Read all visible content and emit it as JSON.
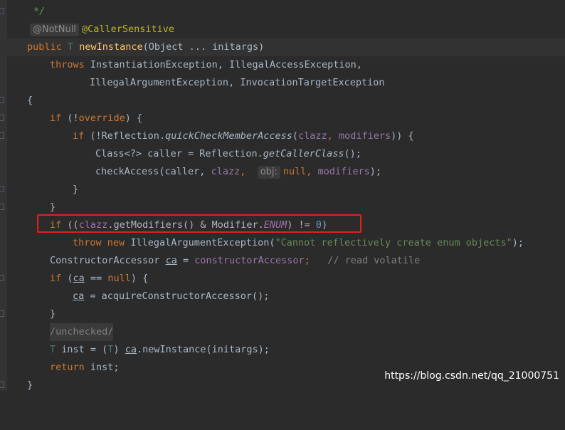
{
  "code": {
    "comment_end": "*/",
    "annotation_hint": "@NotNull",
    "annotation": "@CallerSensitive",
    "kw_public": "public",
    "type_param_T": "T",
    "method_name": "newInstance",
    "sig_params": "(Object ... initargs)",
    "kw_throws": "throws",
    "throws_line1": "InstantiationException, IllegalAccessException,",
    "throws_line2": "IllegalArgumentException, InvocationTargetException",
    "brace_open": "{",
    "brace_close": "}",
    "kw_if": "if",
    "if_override_open": "(!",
    "override_field": "override",
    "if_override_close": ") {",
    "if_reflect_open": "(!Reflection.",
    "quick_check": "quickCheckMemberAccess",
    "paren_open": "(",
    "clazz": "clazz",
    "comma": ",",
    "modifiers": "modifiers",
    "if_reflect_close": ")) {",
    "class_decl": "Class<?> caller = Reflection.",
    "get_caller_class": "getCallerClass",
    "call_end": "();",
    "check_access": "checkAccess(caller,",
    "param_hint": "obj:",
    "kw_null": "null",
    "check_access_end": ");",
    "if_enum_open": "((",
    "get_modifiers": ".getModifiers() & Modifier.",
    "enum_const": "ENUM",
    "enum_neq": ") != ",
    "zero": "0",
    "close_paren": ")",
    "kw_throw": "throw",
    "kw_new": "new",
    "illegal_arg": "IllegalArgumentException(",
    "enum_message": "\"Cannot reflectively create enum objects\"",
    "ctor_accessor_type": "ConstructorAccessor",
    "var_ca": "ca",
    "assign": " = ",
    "constructor_accessor_field": "constructorAccessor",
    "semicolon": ";",
    "read_volatile": "// read volatile",
    "if_ca_eq": " == ",
    "if_ca_close": ") {",
    "acquire_call": " = acquireConstructorAccessor();",
    "unchecked": "/unchecked/",
    "inst_decl": " inst = (",
    "inst_cast_close": ") ",
    "new_instance_call": ".newInstance(initargs);",
    "kw_return": "return",
    "return_inst": " inst;"
  },
  "watermark": "https://blog.csdn.net/qq_21000751",
  "colors": {
    "background": "#2b2b2b",
    "keyword": "#cc7832",
    "method": "#ffc66d",
    "annotation": "#bbb529",
    "field": "#9876aa",
    "string": "#6a8759",
    "number": "#6897bb",
    "comment": "#808080",
    "highlight_box": "#e0201f"
  }
}
